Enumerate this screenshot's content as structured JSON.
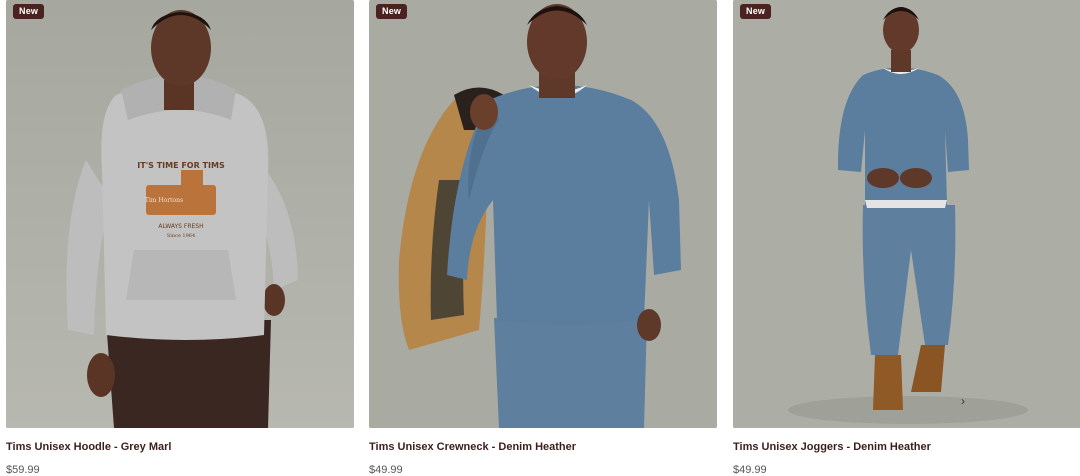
{
  "products": [
    {
      "badge": "New",
      "title": "Tims Unisex Hoodle - Grey Marl",
      "price": "$59.99",
      "hoodie_print": {
        "line1": "IT'S TIME FOR TIMS",
        "line2": "ALWAYS FRESH",
        "line3": "Since 1964",
        "sign": "Tim Hortons"
      }
    },
    {
      "badge": "New",
      "title": "Tims Unisex Crewneck - Denim Heather",
      "price": "$49.99"
    },
    {
      "badge": "New",
      "title": "Tims Unisex Joggers - Denim Heather",
      "price": "$49.99"
    }
  ],
  "carousel": {
    "next_icon": "chevron-right-icon",
    "next_glyph": "›"
  },
  "colors": {
    "brand_dark": "#4a2320",
    "backdrop": "#a9aba2",
    "grey_marl": "#c2c3c2",
    "denim": "#5f7f9f",
    "print_orange": "#b9733b"
  }
}
